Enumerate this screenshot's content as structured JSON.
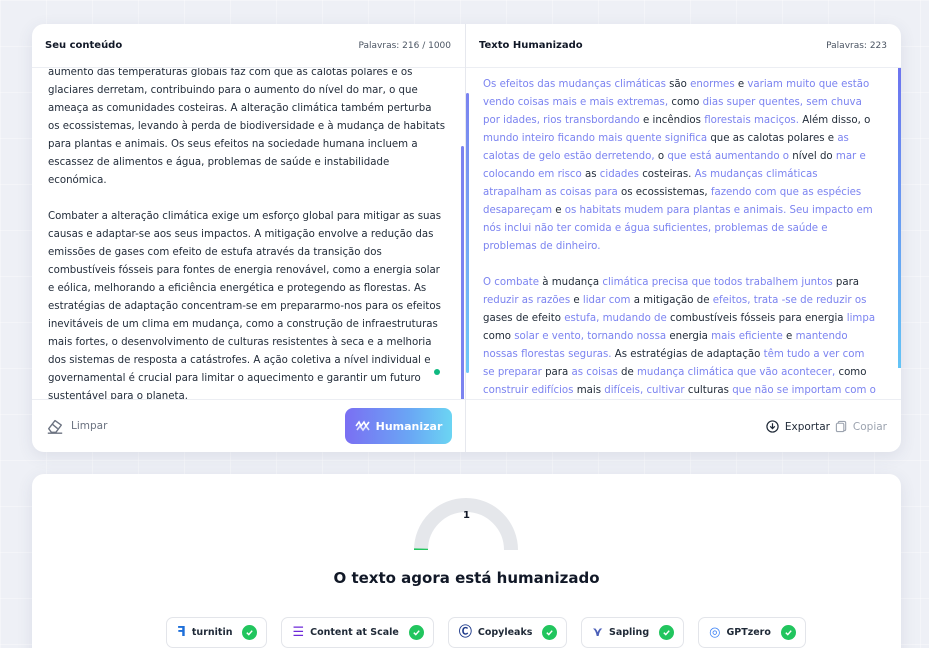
{
  "input_pane": {
    "title": "Seu conteúdo",
    "word_count": "Palavras: 216 / 1000",
    "paragraphs": [
      "aumento das temperaturas globais faz com que as calotas polares e os glaciares derretam, contribuindo para o aumento do nível do mar, o que ameaça as comunidades costeiras. A alteração climática também perturba os ecossistemas, levando à perda de biodiversidade e à mudança de habitats para plantas e animais. Os seus efeitos na sociedade humana incluem a escassez de alimentos e água, problemas de saúde e instabilidade económica.",
      "Combater a alteração climática exige um esforço global para mitigar as suas causas e adaptar-se aos seus impactos. A mitigação envolve a redução das emissões de gases com efeito de estufa através da transição dos combustíveis fósseis para fontes de energia renovável, como a energia solar e eólica, melhorando a eficiência energética e protegendo as florestas. As estratégias de adaptação concentram-se em prepararmo-nos para os efeitos inevitáveis de um clima em mudança, como a construção de infraestruturas mais fortes, o desenvolvimento de culturas resistentes à seca e a melhoria dos sistemas de resposta a catástrofes. A ação coletiva a nível individual e governamental é crucial para limitar o aquecimento e garantir um futuro sustentável para o planeta."
    ],
    "clear_label": "Limpar",
    "humanize_label": "Humanizar"
  },
  "output_pane": {
    "title": "Texto Humanizado",
    "word_count": "Palavras: 223",
    "export_label": "Exportar",
    "copy_label": "Copiar",
    "paragraph1": [
      {
        "t": "Os efeitos das mudanças climáticas",
        "h": true
      },
      {
        "t": " são ",
        "h": false
      },
      {
        "t": "enormes",
        "h": true
      },
      {
        "t": " e ",
        "h": false
      },
      {
        "t": "variam muito que estão vendo coisas mais e mais extremas,",
        "h": true
      },
      {
        "t": " como ",
        "h": false
      },
      {
        "t": "dias super quentes, sem chuva por idades, rios transbordando",
        "h": true
      },
      {
        "t": " e incêndios ",
        "h": false
      },
      {
        "t": "florestais maciços.",
        "h": true
      },
      {
        "t": " Além disso, o ",
        "h": false
      },
      {
        "t": "mundo inteiro ficando mais quente significa",
        "h": true
      },
      {
        "t": " que as calotas polares e ",
        "h": false
      },
      {
        "t": "as calotas de gelo estão derretendo,",
        "h": true
      },
      {
        "t": " o ",
        "h": false
      },
      {
        "t": "que está aumentando o",
        "h": true
      },
      {
        "t": " nível do ",
        "h": false
      },
      {
        "t": "mar e colocando em risco",
        "h": true
      },
      {
        "t": " as ",
        "h": false
      },
      {
        "t": "cidades",
        "h": true
      },
      {
        "t": " costeiras. ",
        "h": false
      },
      {
        "t": "As mudanças climáticas atrapalham as coisas para",
        "h": true
      },
      {
        "t": " os ecossistemas, ",
        "h": false
      },
      {
        "t": "fazendo com que as espécies desapareçam",
        "h": true
      },
      {
        "t": " e ",
        "h": false
      },
      {
        "t": "os habitats mudem para plantas e animais. Seu impacto em nós inclui não ter comida e água suficientes, problemas de saúde e problemas de dinheiro.",
        "h": true
      }
    ],
    "paragraph2": [
      {
        "t": "O combate",
        "h": true
      },
      {
        "t": " à mudança ",
        "h": false
      },
      {
        "t": "climática precisa que todos trabalhem juntos",
        "h": true
      },
      {
        "t": " para ",
        "h": false
      },
      {
        "t": "reduzir as razões",
        "h": true
      },
      {
        "t": " e ",
        "h": false
      },
      {
        "t": "lidar com",
        "h": true
      },
      {
        "t": " a mitigação de ",
        "h": false
      },
      {
        "t": "efeitos, trata -se de reduzir os",
        "h": true
      },
      {
        "t": " gases de efeito ",
        "h": false
      },
      {
        "t": "estufa, mudando de",
        "h": true
      },
      {
        "t": " combustíveis fósseis para energia ",
        "h": false
      },
      {
        "t": "limpa",
        "h": true
      },
      {
        "t": " como ",
        "h": false
      },
      {
        "t": "solar e vento, tornando nossa",
        "h": true
      },
      {
        "t": " energia ",
        "h": false
      },
      {
        "t": "mais eficiente",
        "h": true
      },
      {
        "t": " e ",
        "h": false
      },
      {
        "t": "mantendo nossas florestas seguras.",
        "h": true
      },
      {
        "t": " As estratégias de adaptação ",
        "h": false
      },
      {
        "t": "têm tudo a ver com se preparar",
        "h": true
      },
      {
        "t": " para ",
        "h": false
      },
      {
        "t": "as coisas",
        "h": true
      },
      {
        "t": " de ",
        "h": false
      },
      {
        "t": "mudança climática que vão acontecer,",
        "h": true
      },
      {
        "t": " como ",
        "h": false
      },
      {
        "t": "construir edifícios",
        "h": true
      },
      {
        "t": " mais ",
        "h": false
      },
      {
        "t": "difíceis, cultivar",
        "h": true
      },
      {
        "t": " culturas ",
        "h": false
      },
      {
        "t": "que não se importam com o",
        "h": true
      }
    ]
  },
  "result": {
    "score": "1",
    "score_fraction": 0.01,
    "title": "O texto agora está humanizado",
    "detectors": [
      {
        "name": "turnitin",
        "icon": "turnitin-icon",
        "color": "#1e6fd9"
      },
      {
        "name": "Content at Scale",
        "icon": "content-at-scale-icon",
        "color": "#6d28d9"
      },
      {
        "name": "Copyleaks",
        "icon": "copyleaks-icon",
        "color": "#1e3a8a"
      },
      {
        "name": "Sapling",
        "icon": "sapling-icon",
        "color": "#4b5fb8"
      },
      {
        "name": "GPTzero",
        "icon": "gptzero-icon",
        "color": "#3b82f6"
      }
    ]
  },
  "colors": {
    "accent": "#7b83f0",
    "success": "#22c55e",
    "gauge_track": "#e5e7eb",
    "gauge_fill": "#22c55e"
  }
}
